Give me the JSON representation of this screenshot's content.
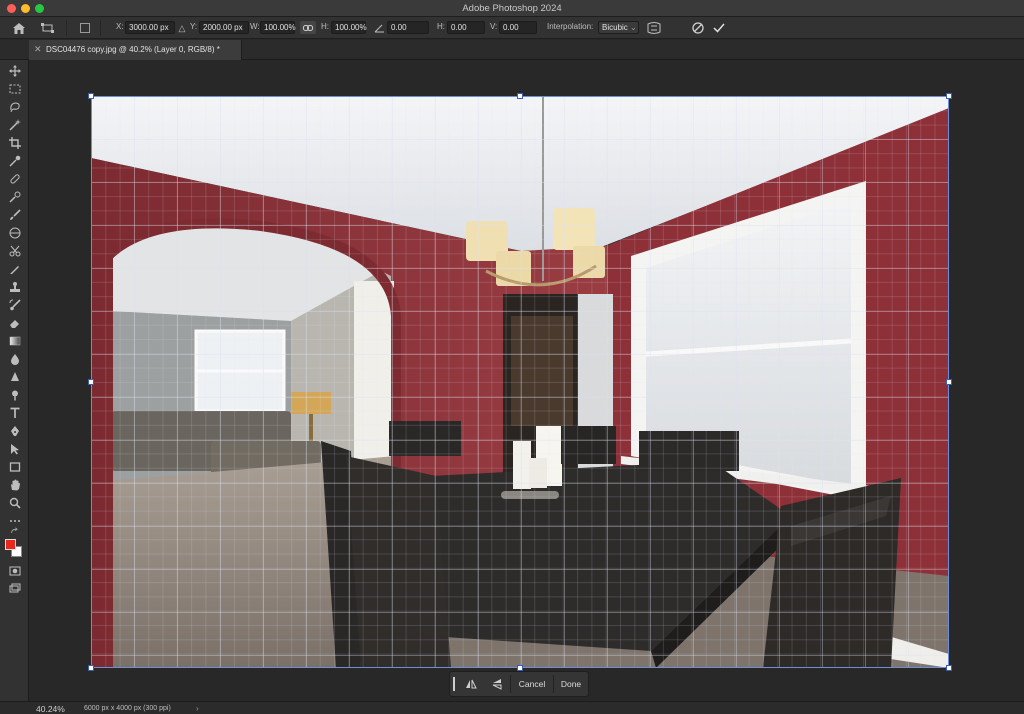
{
  "app": {
    "title": "Adobe Photoshop 2024"
  },
  "options_bar": {
    "x_label": "X:",
    "x_value": "3000.00 px",
    "y_label": "Y:",
    "y_value": "2000.00 px",
    "w_label": "W:",
    "w_value": "100.00%",
    "h_label": "H:",
    "h_value": "100.00%",
    "angle_value": "0.00",
    "hskew_label": "H:",
    "hskew_value": "0.00",
    "vskew_label": "V:",
    "vskew_value": "0.00",
    "interp_label": "Interpolation:",
    "interp_value": "Bicubic",
    "icons": [
      "home-icon",
      "transform-icon",
      "reference-point-icon",
      "link-icon",
      "angle-icon",
      "warp-icon",
      "cancel-icon",
      "commit-icon"
    ]
  },
  "document": {
    "tab_title": "DSC04476 copy.jpg @ 40.2% (Layer 0, RGB/8) *",
    "tab_close": "✕"
  },
  "transform_bar": {
    "cancel_label": "Cancel",
    "done_label": "Done"
  },
  "status": {
    "zoom": "40.24%",
    "doc_info": "6000 px x 4000 px (300 ppi)",
    "arrow": "›"
  },
  "colors": {
    "foreground": "#e8281e",
    "background": "#ffffff",
    "accent": "#6e8fd8"
  }
}
